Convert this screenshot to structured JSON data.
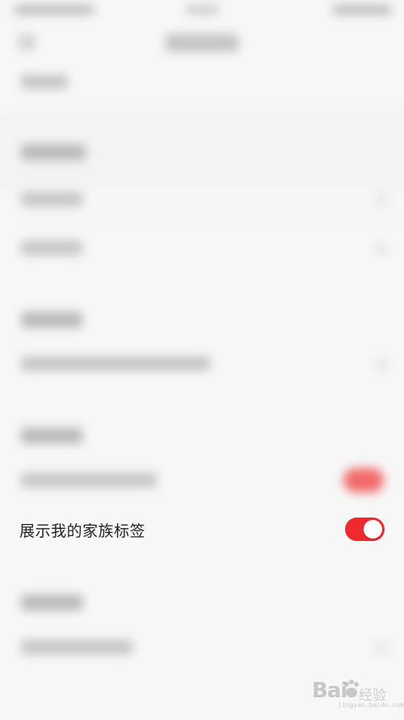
{
  "settings": {
    "family_tag_label": "展示我的家族标签",
    "family_tag_toggle_on": true
  },
  "watermark": {
    "brand_text": "Bai",
    "brand_text2": "经验",
    "url": "jingyan.baidu.com"
  },
  "colors": {
    "toggle_on": "#ee2a2f",
    "background": "#f7f7f7",
    "label_text": "#222222"
  },
  "icons": {
    "back": "back-arrow-icon",
    "chevron": "chevron-right-icon",
    "watermark_paw": "baidu-paw-icon"
  }
}
